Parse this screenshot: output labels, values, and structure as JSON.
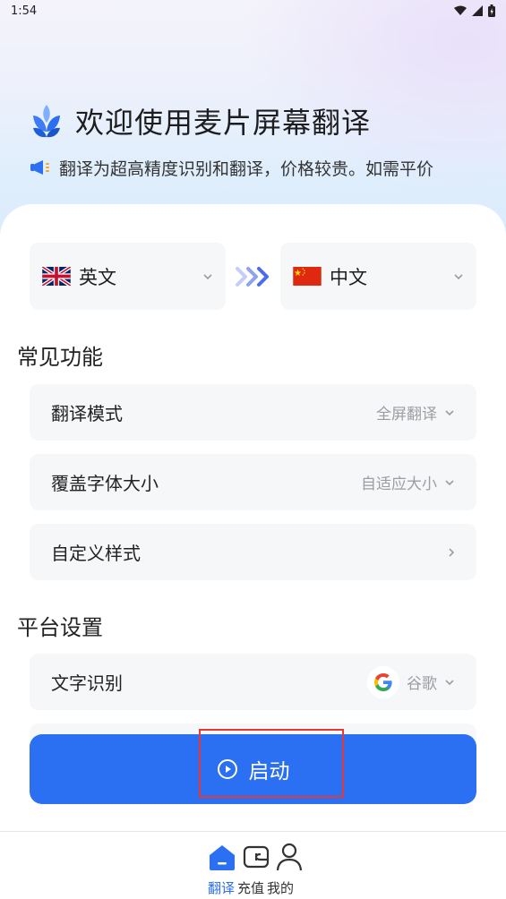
{
  "status": {
    "time": "1:54"
  },
  "header": {
    "welcome_title": "欢迎使用麦片屏幕翻译",
    "notice_text": "翻译为超高精度识别和翻译，价格较贵。如需平价"
  },
  "languages": {
    "source": {
      "label": "英文",
      "flag": "uk-flag-icon"
    },
    "target": {
      "label": "中文",
      "flag": "cn-flag-icon"
    }
  },
  "sections": {
    "common": {
      "title": "常见功能",
      "rows": [
        {
          "label": "翻译模式",
          "value": "全屏翻译"
        },
        {
          "label": "覆盖字体大小",
          "value": "自适应大小"
        },
        {
          "label": "自定义样式",
          "value": ""
        }
      ]
    },
    "platform": {
      "title": "平台设置",
      "rows": [
        {
          "label": "文字识别",
          "value": "谷歌",
          "icon": "google-icon"
        }
      ]
    }
  },
  "start_button": {
    "label": "启动"
  },
  "tabbar": {
    "items": [
      {
        "label": "翻译",
        "active": true
      },
      {
        "label": "充值",
        "active": false
      },
      {
        "label": "我的",
        "active": false
      }
    ]
  },
  "colors": {
    "accent": "#2b6ff2",
    "highlight": "#e53935",
    "row_bg": "#f6f7f9"
  }
}
